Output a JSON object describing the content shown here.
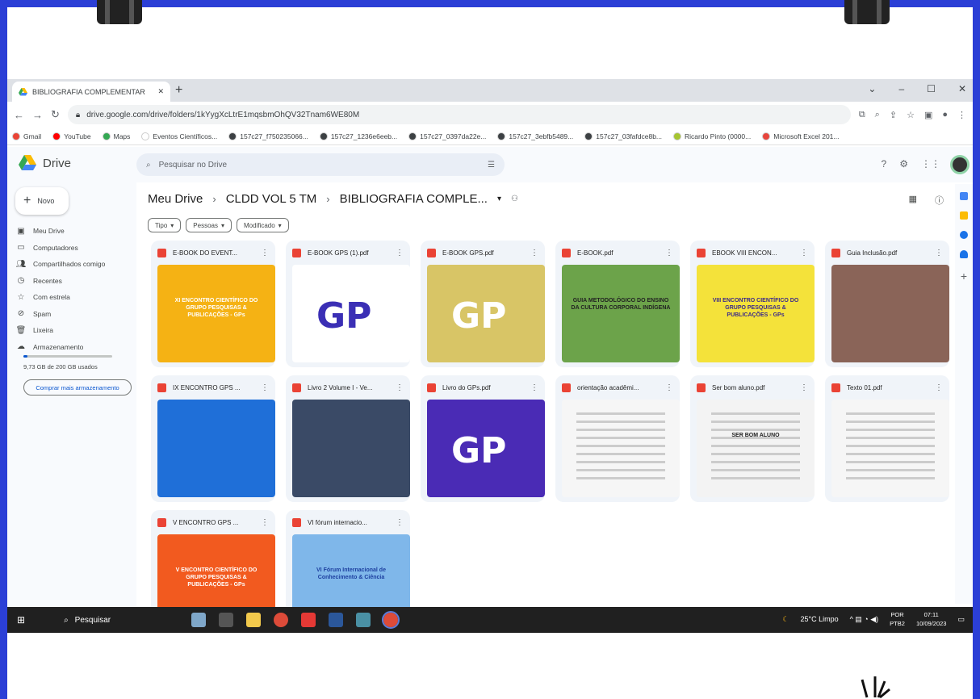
{
  "browser": {
    "tab_title": "BIBLIOGRAFIA COMPLEMENTAR",
    "url": "drive.google.com/drive/folders/1kYygXcLtrE1mqsbmOhQV32Tnam6WE80M"
  },
  "bookmarks": [
    {
      "label": "Gmail",
      "color": "#ea4335"
    },
    {
      "label": "YouTube",
      "color": "#ff0000"
    },
    {
      "label": "Maps",
      "color": "#34a853"
    },
    {
      "label": "Eventos Científicos...",
      "color": "#ffffff"
    },
    {
      "label": "157c27_f750235066...",
      "color": "#3c4043"
    },
    {
      "label": "157c27_1236e6eeb...",
      "color": "#3c4043"
    },
    {
      "label": "157c27_0397da22e...",
      "color": "#3c4043"
    },
    {
      "label": "157c27_3ebfb5489...",
      "color": "#3c4043"
    },
    {
      "label": "157c27_03fafdce8b...",
      "color": "#3c4043"
    },
    {
      "label": "Ricardo Pinto (0000...",
      "color": "#a6c531"
    },
    {
      "label": "Microsoft Excel 201...",
      "color": "#e8453c"
    }
  ],
  "drive": {
    "logo_text": "Drive",
    "search_placeholder": "Pesquisar no Drive",
    "new_button": "Novo",
    "sidebar": [
      {
        "label": "Meu Drive",
        "icon": "drive-icon"
      },
      {
        "label": "Computadores",
        "icon": "computer-icon"
      },
      {
        "label": "Compartilhados comigo",
        "icon": "shared-icon"
      },
      {
        "label": "Recentes",
        "icon": "clock-icon"
      },
      {
        "label": "Com estrela",
        "icon": "star-icon"
      },
      {
        "label": "Spam",
        "icon": "spam-icon"
      },
      {
        "label": "Lixeira",
        "icon": "trash-icon"
      },
      {
        "label": "Armazenamento",
        "icon": "cloud-icon"
      }
    ],
    "storage_text": "9,73 GB de 200 GB usados",
    "storage_fraction": 0.049,
    "buy_storage": "Comprar mais armazenamento",
    "breadcrumb": [
      "Meu Drive",
      "CLDD VOL 5 TM",
      "BIBLIOGRAFIA COMPLE..."
    ],
    "filters": [
      "Tipo",
      "Pessoas",
      "Modificado"
    ],
    "files": [
      {
        "name": "E-BOOK DO EVENT...",
        "thumb": "#f5b214"
      },
      {
        "name": "E-BOOK GPS (1).pdf",
        "thumb": "#ffffff"
      },
      {
        "name": "E-BOOK GPS.pdf",
        "thumb": "#d8c566"
      },
      {
        "name": "E-BOOK.pdf",
        "thumb": "#6ca34a"
      },
      {
        "name": "EBOOK VIII ENCON...",
        "thumb": "#f4e23a"
      },
      {
        "name": "Guia Inclusão.pdf",
        "thumb": "#8a6458"
      },
      {
        "name": "IX ENCONTRO GPS ...",
        "thumb": "#1f6fd8"
      },
      {
        "name": "Livro 2 Volume I - Ve...",
        "thumb": "#3a4a66"
      },
      {
        "name": "Livro do GPs.pdf",
        "thumb": "#4a2bb5"
      },
      {
        "name": "orientação acadêmi...",
        "thumb": "#f6f6f6"
      },
      {
        "name": "Ser bom aluno.pdf",
        "thumb": "#f3f3f3"
      },
      {
        "name": "Texto 01.pdf",
        "thumb": "#f6f6f6"
      },
      {
        "name": "V ENCONTRO GPS ...",
        "thumb": "#f25a1f"
      },
      {
        "name": "VI fórum internacio...",
        "thumb": "#7fb7ea"
      }
    ],
    "thumb_text": {
      "t1": "XI ENCONTRO CIENTÍFICO DO GRUPO PESQUISAS & PUBLICAÇÕES - GPs",
      "t5": "VIII ENCONTRO CIENTÍFICO DO GRUPO PESQUISAS & PUBLICAÇÕES - GPs",
      "t4": "GUIA METODOLÓGICO DO ENSINO DA CULTURA CORPORAL INDÍGENA",
      "t13": "V ENCONTRO CIENTÍFICO DO GRUPO PESQUISAS & PUBLICAÇÕES - GPs",
      "t14": "VI Fórum Internacional de Conhecimento & Ciência",
      "t11": "SER BOM ALUNO"
    }
  },
  "taskbar": {
    "search": "Pesquisar",
    "weather": "25°C Limpo",
    "lang_top": "POR",
    "lang_bottom": "PTB2",
    "time": "07:11",
    "date": "10/09/2023"
  }
}
